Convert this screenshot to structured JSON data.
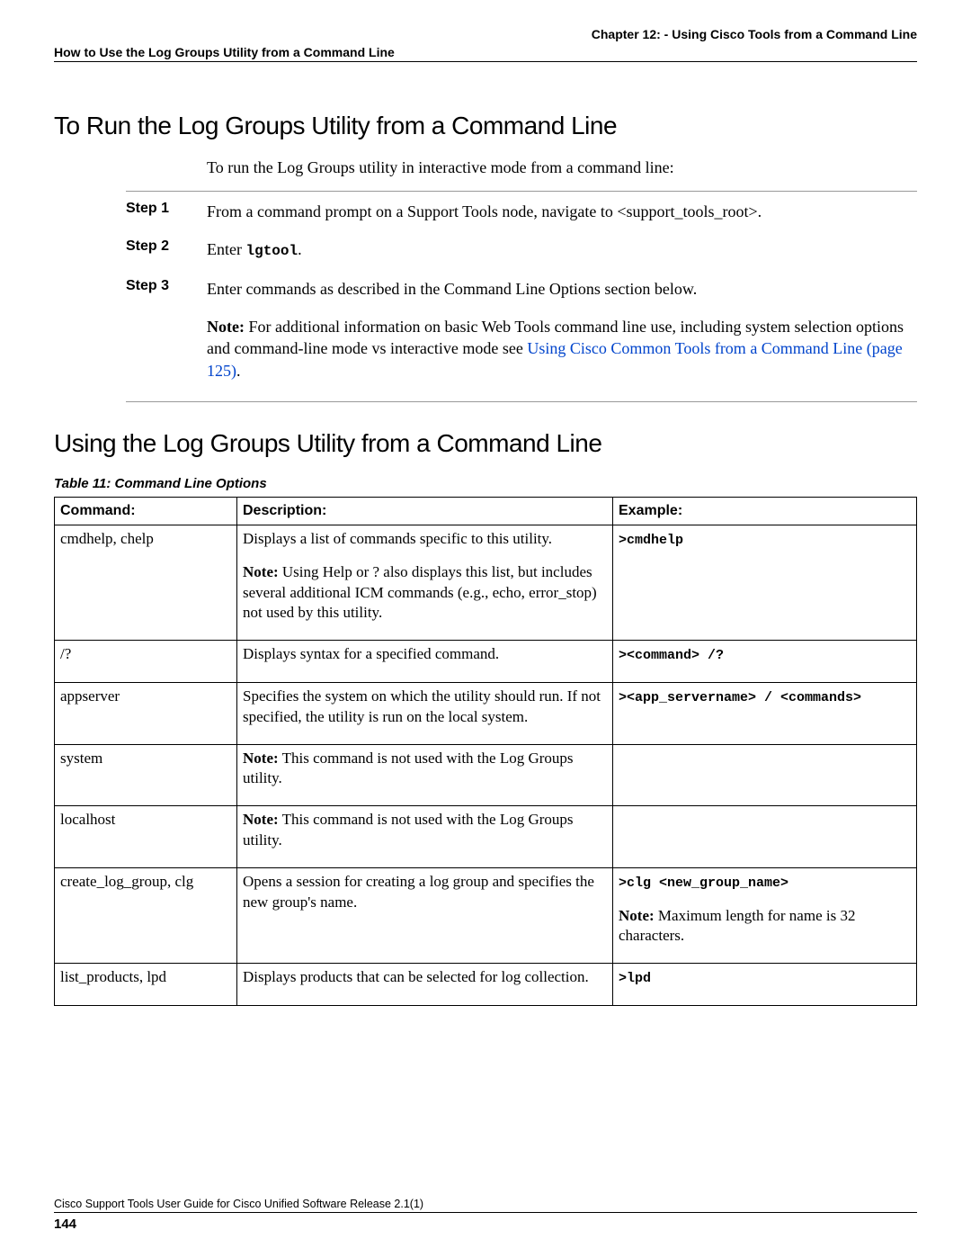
{
  "header": {
    "chapter": "Chapter 12: - Using Cisco Tools from a Command Line",
    "section": "How to Use the Log Groups Utility from a Command Line"
  },
  "h1": "To Run the Log Groups Utility from a Command Line",
  "intro": "To run the Log Groups utility in interactive mode from a command line:",
  "steps": [
    {
      "label": "Step 1",
      "body": "From a command prompt on a Support Tools node, navigate to <support_tools_root>."
    },
    {
      "label": "Step 2",
      "body_prefix": "Enter ",
      "body_mono": "lgtool",
      "body_suffix": "."
    },
    {
      "label": "Step 3",
      "body": "Enter commands as described in the Command Line Options section below."
    }
  ],
  "note": {
    "label": "Note:",
    "body_a": " For additional information on basic Web Tools command line use, including system selection options and command-line mode vs interactive mode see ",
    "link": "Using Cisco Common Tools from a Command Line (page 125)",
    "body_b": "."
  },
  "h2": "Using the Log Groups Utility from a Command Line",
  "table_caption": "Table 11: Command Line Options",
  "table": {
    "headers": {
      "c1": "Command:",
      "c2": "Description:",
      "c3": "Example:"
    },
    "rows": [
      {
        "cmd": "cmdhelp, chelp",
        "desc_main": "Displays a list of commands specific to this utility.",
        "desc_note_label": "Note:",
        "desc_note": " Using Help or ? also displays this list, but includes several additional ICM commands (e.g., echo, error_stop) not used by this utility.",
        "ex_mono": ">cmdhelp"
      },
      {
        "cmd": "/?",
        "desc_main": "Displays syntax for a specified command.",
        "ex_mono": "><command> /?"
      },
      {
        "cmd": "appserver",
        "desc_main": "Specifies the system on which the utility should run. If not specified, the utility is run on the local system.",
        "ex_mono": "><app_servername> / <commands>"
      },
      {
        "cmd": "system",
        "desc_note_label": "Note:",
        "desc_note": " This command is not used with the Log Groups utility.",
        "ex_mono": ""
      },
      {
        "cmd": "localhost",
        "desc_note_label": "Note:",
        "desc_note": " This command is not used with the Log Groups utility.",
        "ex_mono": ""
      },
      {
        "cmd": "create_log_group, clg",
        "desc_main": "Opens a session for creating a log group and specifies the new group's name.",
        "ex_mono": ">clg <new_group_name>",
        "ex_note_label": "Note:",
        "ex_note": " Maximum length for name is 32 characters."
      },
      {
        "cmd": "list_products, lpd",
        "desc_main": "Displays products that can be selected for log collection.",
        "ex_mono": ">lpd"
      }
    ]
  },
  "footer": {
    "line": "Cisco Support Tools User Guide for Cisco Unified Software Release 2.1(1)",
    "page": "144"
  }
}
